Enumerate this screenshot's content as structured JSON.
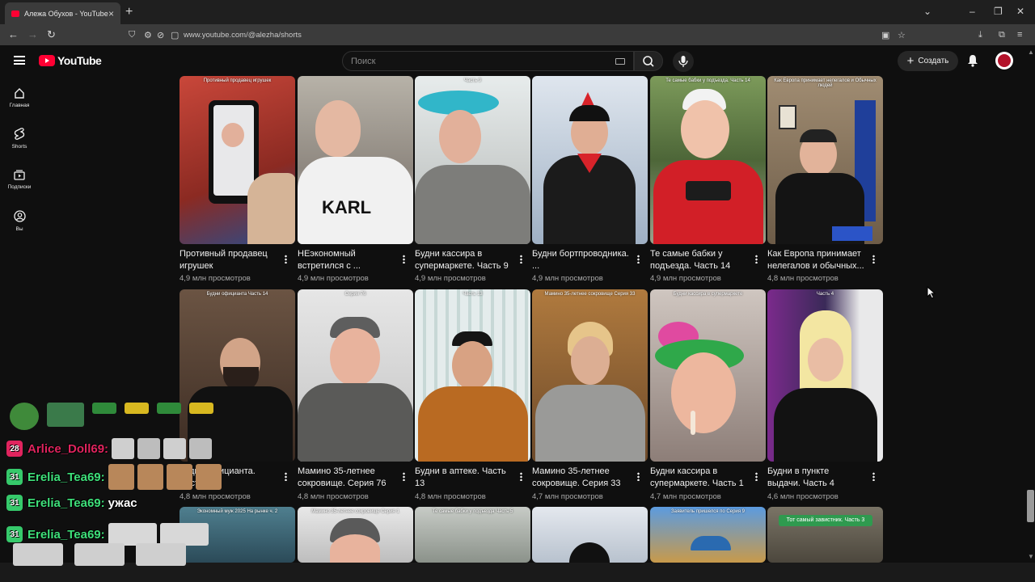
{
  "browser": {
    "tab_title": "Алежа Обухов - YouTube",
    "url": "www.youtube.com/@alezha/shorts"
  },
  "header": {
    "logo_text": "YouTube",
    "search_placeholder": "Поиск",
    "create_label": "Создать"
  },
  "sidebar": {
    "items": [
      {
        "label": "Главная",
        "icon": "home-icon"
      },
      {
        "label": "Shorts",
        "icon": "shorts-icon"
      },
      {
        "label": "Подписки",
        "icon": "subscriptions-icon"
      },
      {
        "label": "Вы",
        "icon": "you-icon"
      }
    ]
  },
  "rows": [
    [
      {
        "title": "Противный продавец игрушек",
        "views": "4,9 млн просмотров",
        "overlay": "Противный продавец игрушек",
        "bg": "#b23a2e"
      },
      {
        "title": "НЕэкономный встретился с ...",
        "views": "4,9 млн просмотров",
        "overlay": "",
        "bg": "#d8d8d8"
      },
      {
        "title": "Будни кассира в супермаркете. Часть 9",
        "views": "4,9 млн просмотров",
        "overlay": "Часть 9",
        "bg": "#8a8f92"
      },
      {
        "title": "Будни бортпроводника. ...",
        "views": "4,9 млн просмотров",
        "overlay": "",
        "bg": "#c9d4df"
      },
      {
        "title": "Те самые бабки у подъезда. Часть 14",
        "views": "4,9 млн просмотров",
        "overlay": "Те самые бабки у подъезда. Часть 14",
        "bg": "#6b7d4c"
      },
      {
        "title": "Как Европа принимает нелегалов и обычных...",
        "views": "4,8 млн просмотров",
        "overlay": "Как Европа принимает нелегалов и Обычных людей",
        "bg": "#7a6a55"
      }
    ],
    [
      {
        "title": "Будни официанта. Часть 14",
        "views": "4,8 млн просмотров",
        "overlay": "Будни официанта Часть 14",
        "bg": "#5a4636"
      },
      {
        "title": "Мамино 35-летнее сокровище. Серия 76",
        "views": "4,8 млн просмотров",
        "overlay": "Серия 76",
        "bg": "#cfcfcf"
      },
      {
        "title": "Будни в аптеке. Часть 13",
        "views": "4,8 млн просмотров",
        "overlay": "Часть 13",
        "bg": "#dfe6e6"
      },
      {
        "title": "Мамино 35-летнее сокровище. Серия 33",
        "views": "4,7 млн просмотров",
        "overlay": "Мамино 35-летнее сокровище Серия 33",
        "bg": "#a7743f"
      },
      {
        "title": "Будни кассира в супермаркете. Часть 1",
        "views": "4,7 млн просмотров",
        "overlay": "Будни кассира в супермаркете",
        "bg": "#b78aa0"
      },
      {
        "title": "Будни в пункте выдачи. Часть 4",
        "views": "4,6 млн просмотров",
        "overlay": "Часть 4",
        "bg": "#7b2a8c"
      }
    ],
    [
      {
        "overlay": "Экономный муж 2025 На рынке ч. 2",
        "bg": "#3a6a7a"
      },
      {
        "overlay": "Мамино 35-летнее сокровище Серия 1",
        "bg": "#bfbfbf"
      },
      {
        "overlay": "Те самые бабки у подъезда Часть 5",
        "bg": "#a9b0a8"
      },
      {
        "overlay": "",
        "bg": "#c8d0d8"
      },
      {
        "overlay": "Заявитель пришелся по Серия 9",
        "bg": "#5b8fc8"
      },
      {
        "overlay": "Тот самый завистник. Часть 3",
        "bg": "#6a6458"
      }
    ]
  ],
  "chat": {
    "lines": [
      {
        "badge": "28",
        "badge_color": "#e0245e",
        "user": "Arlice_Doll69:",
        "user_color": "#e0245e",
        "text": ""
      },
      {
        "badge": "31",
        "badge_color": "#36c96b",
        "user": "Erelia_Tea69:",
        "user_color": "#3ee07a",
        "text": ""
      },
      {
        "badge": "31",
        "badge_color": "#36c96b",
        "user": "Erelia_Tea69:",
        "user_color": "#3ee07a",
        "text": "ужас"
      },
      {
        "badge": "31",
        "badge_color": "#36c96b",
        "user": "Erelia_Tea69:",
        "user_color": "#3ee07a",
        "text": ""
      }
    ]
  }
}
